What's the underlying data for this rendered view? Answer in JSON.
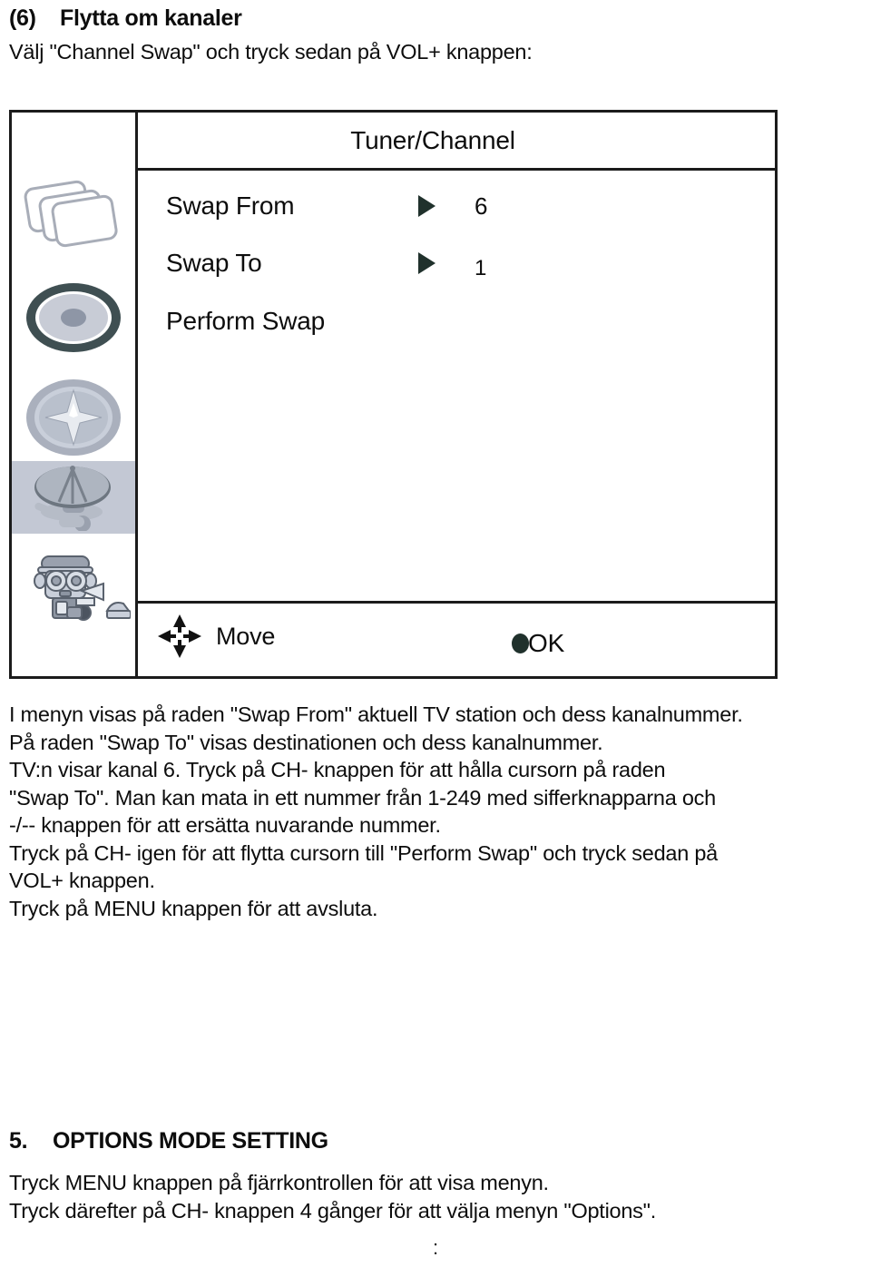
{
  "section_6": {
    "number": "(6)",
    "title": "Flytta om kanaler",
    "intro": "Välj \"Channel Swap\" och tryck sedan på VOL+ knappen:"
  },
  "osd": {
    "title": "Tuner/Channel",
    "rows": [
      {
        "label": "Swap From",
        "arrow": "play-triangle-icon",
        "value": "6"
      },
      {
        "label": "Swap To",
        "arrow": "play-triangle-icon",
        "value": "1"
      },
      {
        "label": "Perform Swap",
        "arrow": "",
        "value": ""
      }
    ],
    "footer": {
      "move_label": "Move",
      "move_icon": "four-way-arrows-icon",
      "ok_label": "OK",
      "ok_icon": "round-dot-icon"
    },
    "sidebar_icons": [
      {
        "name": "stacked-screens-icon",
        "selected": false
      },
      {
        "name": "disc-icon",
        "selected": false
      },
      {
        "name": "compass-icon",
        "selected": false
      },
      {
        "name": "satellite-dish-icon",
        "selected": true
      },
      {
        "name": "installer-person-icon",
        "selected": false
      }
    ],
    "colors": {
      "border": "#1b1b1b",
      "arrow": "#20312c",
      "selection_highlight": "#c3c8d4",
      "icon_gray": "#9aa0ad",
      "icon_dark": "#4c5460"
    }
  },
  "body_1": {
    "lines": [
      "I menyn visas på raden \"Swap From\" aktuell TV station och dess kanalnummer.",
      "På raden \"Swap To\" visas destinationen och dess kanalnummer.",
      "TV:n visar kanal 6. Tryck på CH- knappen för att hålla cursorn på raden",
      "\"Swap To\". Man kan mata in ett nummer från 1-249 med sifferknapparna och",
      "-/-- knappen för att ersätta nuvarande nummer.",
      "Tryck på CH- igen för att flytta cursorn till \"Perform Swap\" och tryck sedan på",
      "VOL+ knappen.",
      "Tryck på MENU knappen för att avsluta."
    ]
  },
  "section_5": {
    "number": "5.",
    "title": "OPTIONS MODE SETTING"
  },
  "body_2": {
    "lines": [
      "Tryck MENU knappen på fjärrkontrollen för att visa menyn.",
      "Tryck därefter på CH- knappen 4 gånger för att välja menyn \"Options\"."
    ]
  },
  "page_artifact": ":"
}
